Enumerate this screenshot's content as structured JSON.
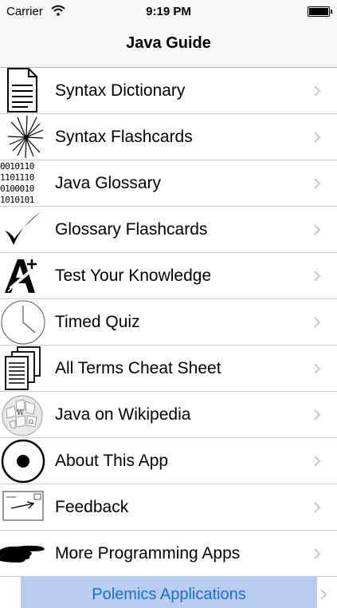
{
  "status_bar": {
    "carrier": "Carrier",
    "time": "9:19 PM"
  },
  "nav": {
    "title": "Java Guide"
  },
  "menu": [
    {
      "label": "Syntax Dictionary",
      "icon": "document-icon"
    },
    {
      "label": "Syntax Flashcards",
      "icon": "starburst-icon"
    },
    {
      "label": "Java Glossary",
      "icon": "binary-icon"
    },
    {
      "label": "Glossary Flashcards",
      "icon": "checkmark-icon"
    },
    {
      "label": "Test Your Knowledge",
      "icon": "grade-a-plus-icon"
    },
    {
      "label": "Timed Quiz",
      "icon": "clock-icon"
    },
    {
      "label": "All Terms Cheat Sheet",
      "icon": "stacked-pages-icon"
    },
    {
      "label": "Java on Wikipedia",
      "icon": "wikipedia-globe-icon"
    },
    {
      "label": "About This App",
      "icon": "dot-circle-icon"
    },
    {
      "label": "Feedback",
      "icon": "envelope-icon"
    },
    {
      "label": "More Programming Apps",
      "icon": "pointing-hand-icon"
    }
  ],
  "binary_lines": [
    "0010110",
    "1101110",
    "0100010",
    "1010101"
  ],
  "banner": {
    "label": "Polemics Applications"
  },
  "colors": {
    "bar_bg": "#f7f7f7",
    "separator": "#c8c7cc",
    "chevron": "#c7c7cc",
    "banner_bg": "#b9cdf0",
    "banner_text": "#1a6fe0"
  }
}
